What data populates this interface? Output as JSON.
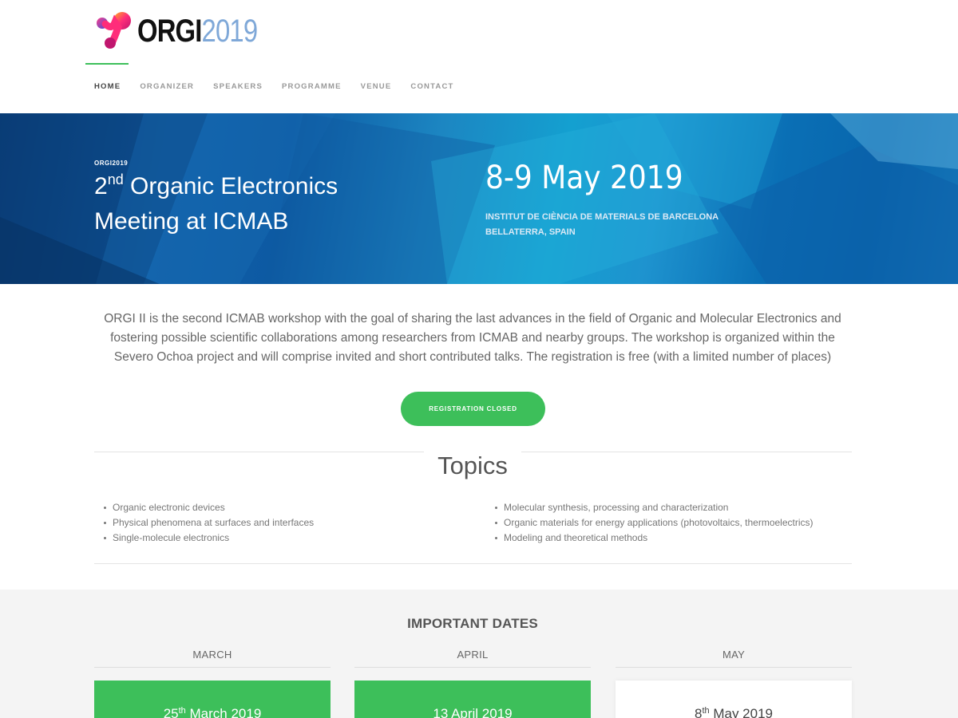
{
  "brand": {
    "logo_text_a": "ORGI",
    "logo_text_b": "2019",
    "accent_color": "#3dbf5a",
    "logo_colors": [
      "#ff2d7a",
      "#ffb31a",
      "#3b4fd8"
    ]
  },
  "nav": {
    "items": [
      {
        "label": "HOME",
        "active": true
      },
      {
        "label": "ORGANIZER",
        "active": false
      },
      {
        "label": "SPEAKERS",
        "active": false
      },
      {
        "label": "PROGRAMME",
        "active": false
      },
      {
        "label": "VENUE",
        "active": false
      },
      {
        "label": "CONTACT",
        "active": false
      }
    ]
  },
  "hero": {
    "kicker": "ORGI2019",
    "title_ordinal_num": "2",
    "title_ordinal_suffix": "nd",
    "title_rest_line1": " Organic Electronics",
    "title_line2": "Meeting at ICMAB",
    "date": "8-9 May 2019",
    "venue_line1": "INSTITUT DE CIÈNCIA DE MATERIALS DE BARCELONA",
    "venue_line2": "BELLATERRA, SPAIN"
  },
  "intro": {
    "text": "ORGI II is the second ICMAB workshop with the goal of sharing the last advances in the field of Organic and Molecular Electronics and fostering possible scientific collaborations among researchers from ICMAB and nearby groups. The workshop is organized within the Severo Ochoa project and will comprise invited and short contributed talks. The registration is free (with a limited number of places)",
    "registration_button": "REGISTRATION CLOSED"
  },
  "topics": {
    "title": "Topics",
    "left": [
      "Organic electronic devices",
      "Physical phenomena at surfaces and interfaces",
      "Single-molecule electronics"
    ],
    "right": [
      "Molecular synthesis, processing and characterization",
      "Organic materials for energy applications (photovoltaics, thermoelectrics)",
      "Modeling and theoretical methods"
    ]
  },
  "important_dates": {
    "title": "IMPORTANT DATES",
    "columns": [
      {
        "month": "MARCH",
        "day": "25",
        "suffix": "th",
        "rest": " March 2019"
      },
      {
        "month": "APRIL",
        "day": "",
        "suffix": "",
        "rest": "13 April 2019"
      },
      {
        "month": "MAY",
        "day": "8",
        "suffix": "th",
        "rest": " May 2019"
      }
    ]
  }
}
